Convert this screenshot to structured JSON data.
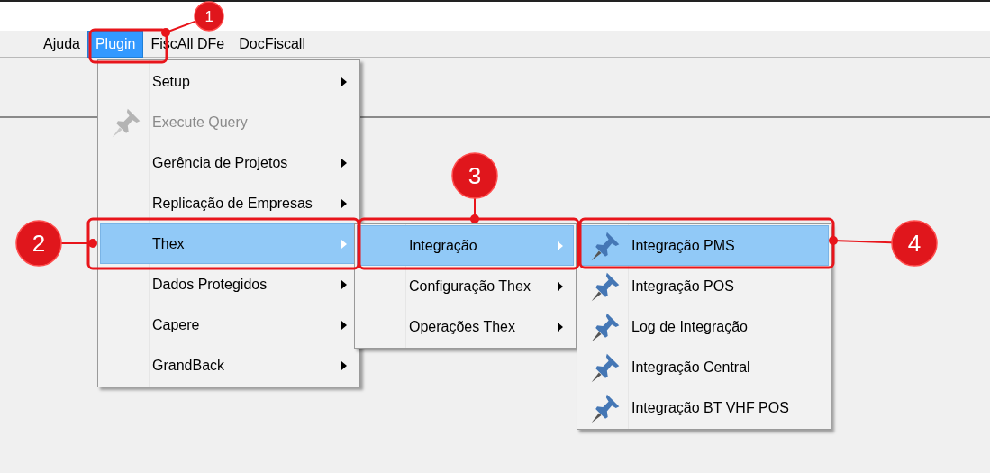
{
  "menubar": [
    {
      "label": "Ajuda",
      "selected": false
    },
    {
      "label": "Plugin",
      "selected": true
    },
    {
      "label": "FiscAll DFe",
      "selected": false
    },
    {
      "label": "DocFiscall",
      "selected": false
    }
  ],
  "menus": [
    {
      "items": [
        {
          "label": "Setup",
          "kind": "submenu",
          "disabled": false,
          "selected": false
        },
        {
          "label": "Execute Query",
          "kind": "command",
          "disabled": true,
          "selected": false
        },
        {
          "label": "Gerência de Projetos",
          "kind": "submenu",
          "disabled": false,
          "selected": false
        },
        {
          "label": "Replicação de Empresas",
          "kind": "submenu",
          "disabled": false,
          "selected": false
        },
        {
          "label": "Thex",
          "kind": "submenu",
          "disabled": false,
          "selected": true
        },
        {
          "label": "Dados Protegidos",
          "kind": "submenu",
          "disabled": false,
          "selected": false
        },
        {
          "label": "Capere",
          "kind": "submenu",
          "disabled": false,
          "selected": false
        },
        {
          "label": "GrandBack",
          "kind": "submenu",
          "disabled": false,
          "selected": false
        }
      ]
    },
    {
      "items": [
        {
          "label": "Integração",
          "kind": "submenu",
          "disabled": false,
          "selected": true
        },
        {
          "label": "Configuração Thex",
          "kind": "submenu",
          "disabled": false,
          "selected": false
        },
        {
          "label": "Operações Thex",
          "kind": "submenu",
          "disabled": false,
          "selected": false
        }
      ]
    },
    {
      "items": [
        {
          "label": "Integração PMS",
          "kind": "command",
          "disabled": false,
          "selected": true
        },
        {
          "label": "Integração POS",
          "kind": "command",
          "disabled": false,
          "selected": false
        },
        {
          "label": "Log de Integração",
          "kind": "command",
          "disabled": false,
          "selected": false
        },
        {
          "label": "Integração Central",
          "kind": "command",
          "disabled": false,
          "selected": false
        },
        {
          "label": "Integração BT VHF POS",
          "kind": "command",
          "disabled": false,
          "selected": false
        }
      ]
    }
  ],
  "annotations": [
    {
      "number": "1"
    },
    {
      "number": "2"
    },
    {
      "number": "3"
    },
    {
      "number": "4"
    }
  ]
}
